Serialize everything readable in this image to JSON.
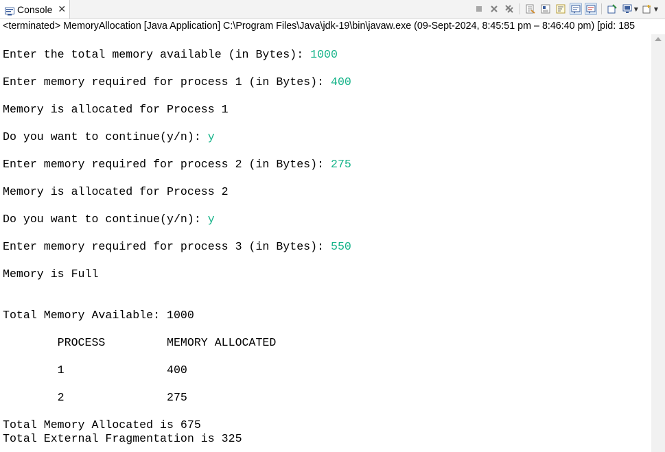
{
  "tab": {
    "label": "Console",
    "close": "✕"
  },
  "toolbar": {
    "icons": [
      "terminate-icon",
      "remove-launch-icon",
      "remove-all-icon",
      "clear-console-icon",
      "scroll-lock-icon",
      "word-wrap-icon",
      "show-on-stdout-icon",
      "show-on-stderr-icon",
      "pin-console-icon",
      "display-console-icon",
      "open-console-icon"
    ]
  },
  "status": "<terminated> MemoryAllocation [Java Application] C:\\Program Files\\Java\\jdk-19\\bin\\javaw.exe  (09-Sept-2024, 8:45:51 pm – 8:46:40 pm) [pid: 185",
  "console": {
    "l1_prompt": "Enter the total memory available (in Bytes): ",
    "l1_input": "1000",
    "l2_prompt": "Enter memory required for process 1 (in Bytes): ",
    "l2_input": "400",
    "l3": "Memory is allocated for Process 1",
    "l4_prompt": "Do you want to continue(y/n): ",
    "l4_input": "y",
    "l5_prompt": "Enter memory required for process 2 (in Bytes): ",
    "l5_input": "275",
    "l6": "Memory is allocated for Process 2",
    "l7_prompt": "Do you want to continue(y/n): ",
    "l7_input": "y",
    "l8_prompt": "Enter memory required for process 3 (in Bytes): ",
    "l8_input": "550",
    "l9": "Memory is Full",
    "l10": "Total Memory Available: 1000",
    "table_header": "        PROCESS         MEMORY ALLOCATED",
    "row1": "        1               400",
    "row2": "        2               275",
    "l11": "Total Memory Allocated is 675",
    "l12": "Total External Fragmentation is 325"
  }
}
